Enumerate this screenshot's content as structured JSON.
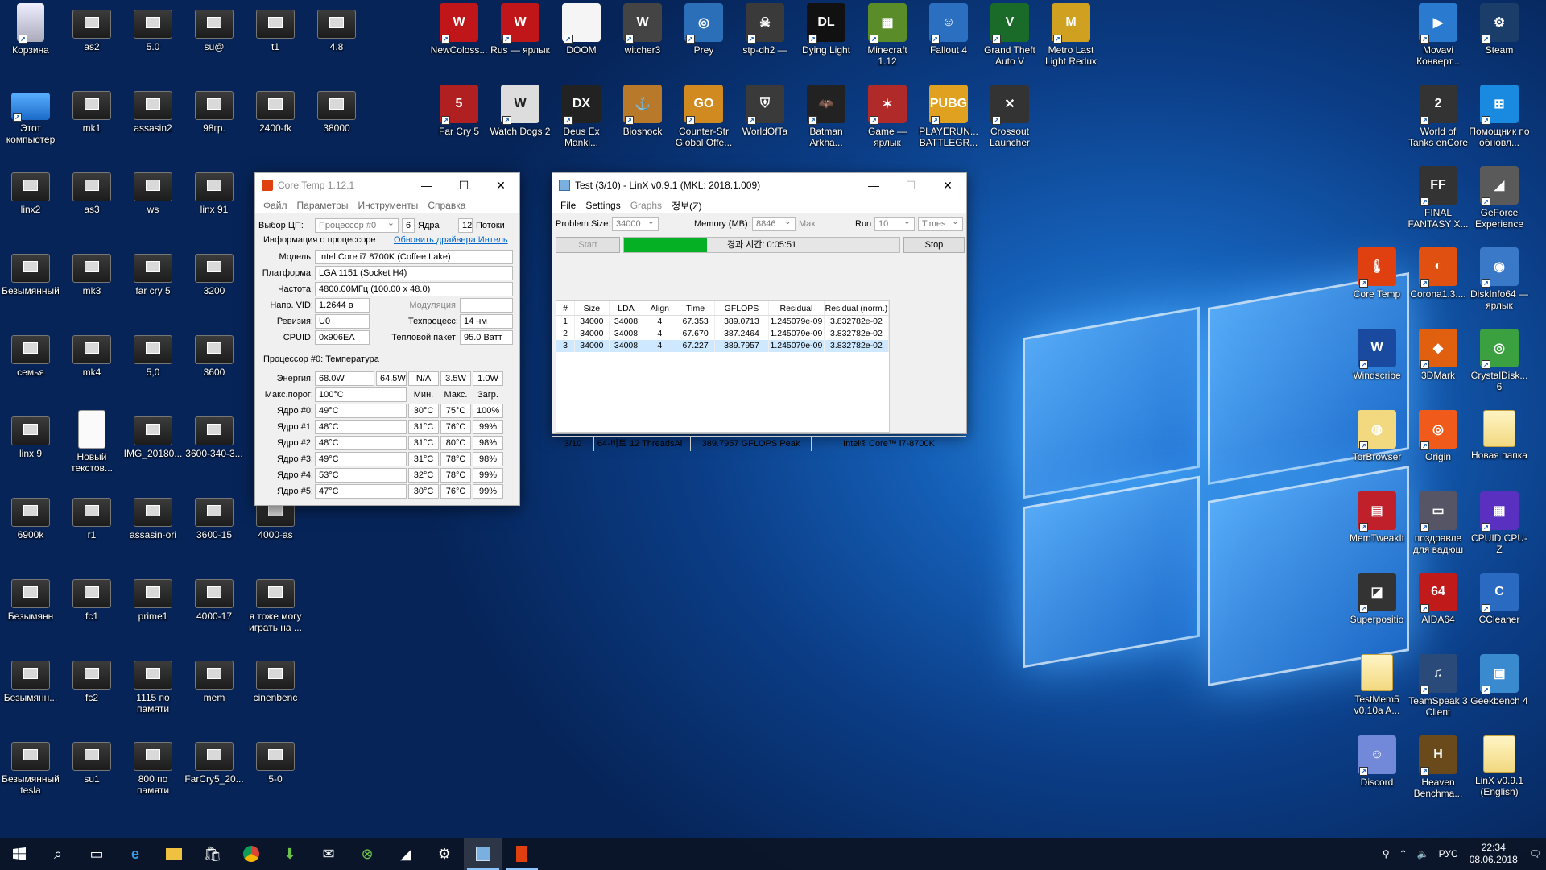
{
  "desktop": {
    "left_icons": [
      {
        "label": "Корзина",
        "kind": "recycle"
      },
      {
        "label": "as2",
        "kind": "thumb"
      },
      {
        "label": "5.0",
        "kind": "thumb"
      },
      {
        "label": "su@",
        "kind": "thumb"
      },
      {
        "label": "t1",
        "kind": "thumb"
      },
      {
        "label": "4.8",
        "kind": "thumb"
      },
      {
        "label": "Этот компьютер",
        "kind": "pc"
      },
      {
        "label": "mk1",
        "kind": "thumb"
      },
      {
        "label": "assasin2",
        "kind": "thumb"
      },
      {
        "label": "98гр.",
        "kind": "thumb"
      },
      {
        "label": "2400-fk",
        "kind": "thumb"
      },
      {
        "label": "38000",
        "kind": "thumb"
      },
      {
        "label": "linx2",
        "kind": "thumb"
      },
      {
        "label": "as3",
        "kind": "thumb"
      },
      {
        "label": "ws",
        "kind": "thumb"
      },
      {
        "label": "linx 91",
        "kind": "thumb"
      },
      {
        "label": "Безымянный",
        "kind": "thumb"
      },
      {
        "label": "mk3",
        "kind": "thumb"
      },
      {
        "label": "far cry 5",
        "kind": "thumb"
      },
      {
        "label": "3200",
        "kind": "thumb"
      },
      {
        "label": "семья",
        "kind": "thumb"
      },
      {
        "label": "mk4",
        "kind": "thumb"
      },
      {
        "label": "5,0",
        "kind": "thumb"
      },
      {
        "label": "3600",
        "kind": "thumb"
      },
      {
        "label": "linx 9",
        "kind": "thumb"
      },
      {
        "label": "Новый текстов...",
        "kind": "doc"
      },
      {
        "label": "IMG_20180...",
        "kind": "thumb"
      },
      {
        "label": "3600-340-3...",
        "kind": "thumb"
      },
      {
        "label": "6900k",
        "kind": "thumb"
      },
      {
        "label": "r1",
        "kind": "thumb"
      },
      {
        "label": "assasin-ori",
        "kind": "thumb"
      },
      {
        "label": "3600-15",
        "kind": "thumb"
      },
      {
        "label": "4000-as",
        "kind": "thumb"
      },
      {
        "label": "Безымянн",
        "kind": "thumb"
      },
      {
        "label": "fc1",
        "kind": "thumb"
      },
      {
        "label": "prime1",
        "kind": "thumb"
      },
      {
        "label": "4000-17",
        "kind": "thumb"
      },
      {
        "label": "я тоже могу играть на ...",
        "kind": "thumb"
      },
      {
        "label": "Безымянн...",
        "kind": "thumb"
      },
      {
        "label": "fc2",
        "kind": "thumb"
      },
      {
        "label": "1115 по памяти",
        "kind": "thumb"
      },
      {
        "label": "mem",
        "kind": "thumb"
      },
      {
        "label": "cinenbenc",
        "kind": "thumb"
      },
      {
        "label": "Безымянный tesla",
        "kind": "thumb"
      },
      {
        "label": "su1",
        "kind": "thumb"
      },
      {
        "label": "800 по памяти",
        "kind": "thumb"
      },
      {
        "label": "FarCry5_20...",
        "kind": "thumb"
      },
      {
        "label": "5-0",
        "kind": "thumb"
      }
    ],
    "top_icons": [
      {
        "label": "NewColoss...",
        "color": "#c0161a",
        "glyph": "W"
      },
      {
        "label": "Rus — ярлык",
        "color": "#c0161a",
        "glyph": "W"
      },
      {
        "label": "DOOM",
        "color": "#f5f5f5",
        "glyph": ""
      },
      {
        "label": "witcher3",
        "color": "#444",
        "glyph": "W"
      },
      {
        "label": "Prey",
        "color": "#2a6fb8",
        "glyph": "◎"
      },
      {
        "label": "stp-dh2 —",
        "color": "#3a3a3a",
        "glyph": "☠"
      },
      {
        "label": "Dying Light",
        "color": "#111",
        "glyph": "DL"
      },
      {
        "label": "Minecraft 1.12",
        "color": "#5a8c2a",
        "glyph": "▦"
      },
      {
        "label": "Fallout 4",
        "color": "#2a6fc0",
        "glyph": "☺"
      },
      {
        "label": "Grand Theft Auto V",
        "color": "#1a6a2a",
        "glyph": "V"
      },
      {
        "label": "Metro Last Light Redux",
        "color": "#d0a020",
        "glyph": "M"
      },
      {
        "label": "Far Cry 5",
        "color": "#b02020",
        "glyph": "5"
      },
      {
        "label": "Watch Dogs 2",
        "color": "#ddd",
        "glyph": "W"
      },
      {
        "label": "Deus Ex Manki...",
        "color": "#222",
        "glyph": "DX"
      },
      {
        "label": "Bioshock",
        "color": "#b87a2a",
        "glyph": "⚓"
      },
      {
        "label": "Counter-Str Global Offe...",
        "color": "#d08a20",
        "glyph": "GO"
      },
      {
        "label": "WorldOfTa",
        "color": "#3a3a3a",
        "glyph": "⛨"
      },
      {
        "label": "Batman Arkha...",
        "color": "#222",
        "glyph": "🦇"
      },
      {
        "label": "Game — ярлык",
        "color": "#b02a2a",
        "glyph": "✶"
      },
      {
        "label": "PLAYERUN... BATTLEGR...",
        "color": "#e0a020",
        "glyph": "PUBG"
      },
      {
        "label": "Crossout Launcher",
        "color": "#333",
        "glyph": "✕"
      }
    ],
    "right_icons": [
      {
        "label": "Movavi Конверт...",
        "color": "#2a7ad0",
        "glyph": "▶"
      },
      {
        "label": "Steam",
        "color": "#1b3d6a",
        "glyph": "⚙"
      },
      {
        "label": "World of Tanks enCore",
        "color": "#333",
        "glyph": "2"
      },
      {
        "label": "Помощник по обновл...",
        "color": "#1a8ae0",
        "glyph": "⊞"
      },
      {
        "label": "FINAL FANTASY X...",
        "color": "#333",
        "glyph": "FF"
      },
      {
        "label": "GeForce Experience",
        "color": "#5a5a5a",
        "glyph": "◢"
      },
      {
        "label": "Core Temp",
        "color": "#e04010",
        "glyph": "🌡"
      },
      {
        "label": "Corona1.3....",
        "color": "#e05010",
        "glyph": "◐"
      },
      {
        "label": "DiskInfo64 — ярлык",
        "color": "#3a78c8",
        "glyph": "◉"
      },
      {
        "label": "Windscribe",
        "color": "#1a4aa0",
        "glyph": "W"
      },
      {
        "label": "3DMark",
        "color": "#e06010",
        "glyph": "◆"
      },
      {
        "label": "CrystalDisk... 6",
        "color": "#3aa040",
        "glyph": "◎"
      },
      {
        "label": "TorBrowser",
        "color": "#f2d980",
        "glyph": "◍"
      },
      {
        "label": "Origin",
        "color": "#f05a1a",
        "glyph": "◎"
      },
      {
        "label": "Новая папка",
        "color": "#f2d980",
        "glyph": ""
      },
      {
        "label": "MemTweakIt",
        "color": "#c0202a",
        "glyph": "▤"
      },
      {
        "label": "поздравле для вадюш",
        "color": "#556",
        "glyph": "▭"
      },
      {
        "label": "CPUID CPU-Z",
        "color": "#5a30c0",
        "glyph": "▦"
      },
      {
        "label": "Superpositio",
        "color": "#333",
        "glyph": "◪"
      },
      {
        "label": "AIDA64",
        "color": "#c01a1a",
        "glyph": "64"
      },
      {
        "label": "CCleaner",
        "color": "#2a6ac0",
        "glyph": "C"
      },
      {
        "label": "TestMem5 v0.10a A...",
        "color": "#f2d980",
        "glyph": ""
      },
      {
        "label": "TeamSpeak 3 Client",
        "color": "#2a4a7a",
        "glyph": "♫"
      },
      {
        "label": "Geekbench 4",
        "color": "#3a8ad0",
        "glyph": "▣"
      },
      {
        "label": "Discord",
        "color": "#7289da",
        "glyph": "☺"
      },
      {
        "label": "Heaven Benchma...",
        "color": "#6a4a1a",
        "glyph": "H"
      },
      {
        "label": "LinX v0.9.1 (English)",
        "color": "#f2d980",
        "glyph": ""
      }
    ]
  },
  "coretemp": {
    "title": "Core Temp 1.12.1",
    "menu": [
      "Файл",
      "Параметры",
      "Инструменты",
      "Справка"
    ],
    "cpu_select_label": "Выбор ЦП:",
    "cpu_select_value": "Процессор #0",
    "cores": "6",
    "cores_label": "Ядра",
    "threads": "12",
    "threads_label": "Потоки",
    "info_header": "Информация о процессоре",
    "update_link": "Обновить драйвера Интель",
    "model_label": "Модель:",
    "model": "Intel Core i7 8700K (Coffee Lake)",
    "platform_label": "Платформа:",
    "platform": "LGA 1151 (Socket H4)",
    "freq_label": "Частота:",
    "freq": "4800.00МГц (100.00 x 48.0)",
    "vid_label": "Напр. VID:",
    "vid": "1.2644 в",
    "mod_label": "Модуляция:",
    "rev_label": "Ревизия:",
    "rev": "U0",
    "tech_label": "Техпроцесс:",
    "tech": "14 нм",
    "cpuid_label": "CPUID:",
    "cpuid": "0x906EA",
    "tdp_label": "Тепловой пакет:",
    "tdp": "95.0 Ватт",
    "temp_header": "Процессор #0: Температура",
    "power_label": "Энергия:",
    "power": [
      "68.0W",
      "64.5W",
      "N/A",
      "3.5W",
      "1.0W"
    ],
    "tjmax_label": "Макс.порог:",
    "tjmax": "100°C",
    "col_min": "Мин.",
    "col_max": "Макс.",
    "col_load": "Загр.",
    "cores_rows": [
      {
        "name": "Ядро #0:",
        "t": "49°C",
        "min": "30°C",
        "max": "75°C",
        "load": "100%"
      },
      {
        "name": "Ядро #1:",
        "t": "48°C",
        "min": "31°C",
        "max": "76°C",
        "load": "99%"
      },
      {
        "name": "Ядро #2:",
        "t": "48°C",
        "min": "31°C",
        "max": "80°C",
        "load": "98%"
      },
      {
        "name": "Ядро #3:",
        "t": "49°C",
        "min": "31°C",
        "max": "78°C",
        "load": "98%"
      },
      {
        "name": "Ядро #4:",
        "t": "53°C",
        "min": "32°C",
        "max": "78°C",
        "load": "99%"
      },
      {
        "name": "Ядро #5:",
        "t": "47°C",
        "min": "30°C",
        "max": "76°C",
        "load": "99%"
      }
    ]
  },
  "linx": {
    "title": "Test (3/10) - LinX v0.9.1 (MKL: 2018.1.009)",
    "menu": [
      "File",
      "Settings",
      "Graphs",
      "정보(Z)"
    ],
    "problem_label": "Problem Size:",
    "problem": "34000",
    "memory_label": "Memory (MB):",
    "memory": "8846",
    "max_label": "Max",
    "run_label": "Run",
    "run": "10",
    "times": "Times",
    "start": "Start",
    "stop": "Stop",
    "elapsed": "경과 시간: 0:05:51",
    "progress": 0.3,
    "columns": [
      "#",
      "Size",
      "LDA",
      "Align",
      "Time",
      "GFLOPS",
      "Residual",
      "Residual (norm.)"
    ],
    "rows": [
      [
        "1",
        "34000",
        "34008",
        "4",
        "67.353",
        "389.0713",
        "1.245079e-09",
        "3.832782e-02"
      ],
      [
        "2",
        "34000",
        "34008",
        "4",
        "67.670",
        "387.2464",
        "1.245079e-09",
        "3.832782e-02"
      ],
      [
        "3",
        "34000",
        "34008",
        "4",
        "67.227",
        "389.7957",
        "1.245079e-09",
        "3.832782e-02"
      ]
    ],
    "status": [
      "3/10",
      "64-비트",
      "12 ThreadsAl",
      "389.7957 GFLOPS Peak",
      "Intel® Core™ i7-8700K"
    ]
  },
  "taskbar": {
    "lang": "РУС",
    "time": "22:34",
    "date": "08.06.2018"
  }
}
